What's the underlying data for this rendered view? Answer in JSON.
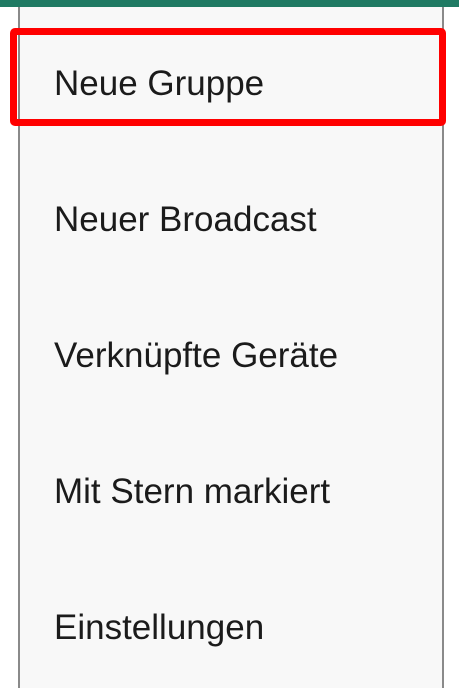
{
  "menu": {
    "items": [
      {
        "id": "new-group",
        "label": "Neue Gruppe"
      },
      {
        "id": "new-broadcast",
        "label": "Neuer Broadcast"
      },
      {
        "id": "linked-devices",
        "label": "Verknüpfte Geräte"
      },
      {
        "id": "starred",
        "label": "Mit Stern markiert"
      },
      {
        "id": "settings",
        "label": "Einstellungen"
      }
    ],
    "highlighted_item": "Neue Gruppe"
  },
  "colors": {
    "app_bar": "#1f7a63",
    "menu_background": "#f8f8f8",
    "text": "#1b1b1b",
    "highlight": "#ff0000"
  }
}
